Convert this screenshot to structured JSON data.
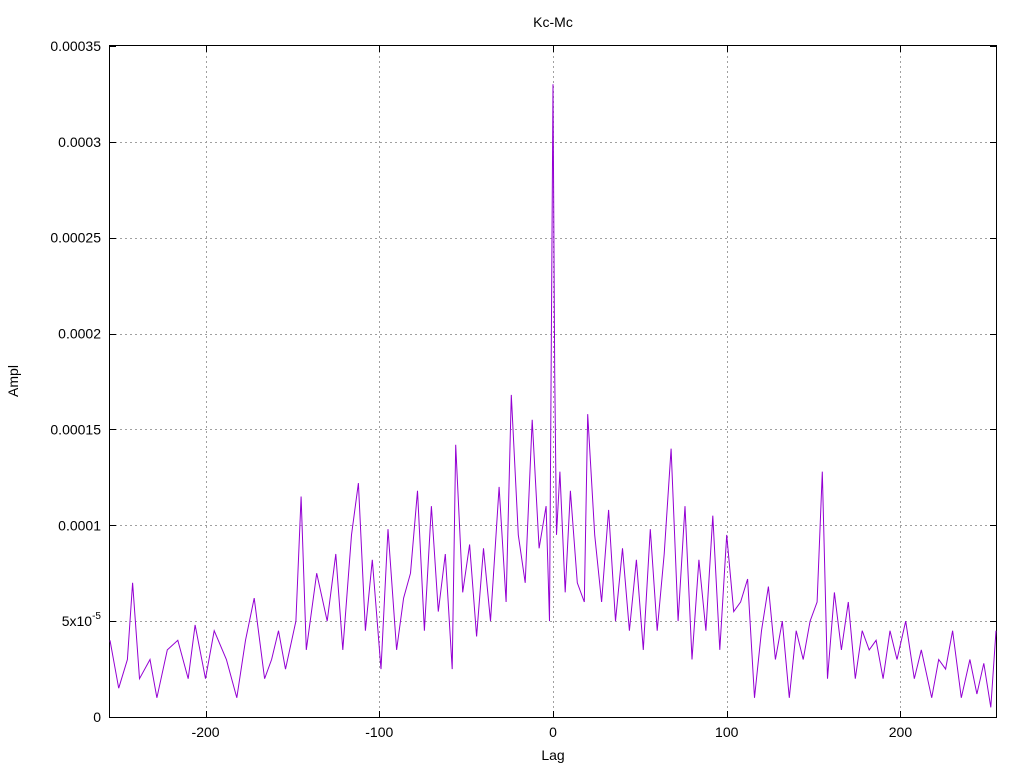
{
  "chart_data": {
    "type": "line",
    "title": "Kc-Mc",
    "xlabel": "Lag",
    "ylabel": "Ampl",
    "xlim": [
      -255,
      255
    ],
    "ylim": [
      0,
      0.00035
    ],
    "x_ticks": [
      -200,
      -100,
      0,
      100,
      200
    ],
    "x_tick_labels": [
      "-200",
      "-100",
      "0",
      "100",
      "200"
    ],
    "y_ticks": [
      0,
      5e-05,
      0.0001,
      0.00015,
      0.0002,
      0.00025,
      0.0003,
      0.00035
    ],
    "y_tick_labels": [
      "0",
      "5x10",
      "0.0001",
      "0.00015",
      "0.0002",
      "0.00025",
      "0.0003",
      "0.00035"
    ],
    "y_tick_exponent": "-5",
    "grid": true,
    "line_color": "#9400d3",
    "series": [
      {
        "points": [
          [
            -255,
            4e-05
          ],
          [
            -250,
            1.5e-05
          ],
          [
            -245,
            3e-05
          ],
          [
            -242,
            7e-05
          ],
          [
            -238,
            2e-05
          ],
          [
            -232,
            3e-05
          ],
          [
            -228,
            1e-05
          ],
          [
            -222,
            3.5e-05
          ],
          [
            -216,
            4e-05
          ],
          [
            -210,
            2e-05
          ],
          [
            -206,
            4.8e-05
          ],
          [
            -200,
            2e-05
          ],
          [
            -195,
            4.5e-05
          ],
          [
            -188,
            3e-05
          ],
          [
            -182,
            1e-05
          ],
          [
            -177,
            4e-05
          ],
          [
            -172,
            6.2e-05
          ],
          [
            -166,
            2e-05
          ],
          [
            -162,
            3e-05
          ],
          [
            -158,
            4.5e-05
          ],
          [
            -154,
            2.5e-05
          ],
          [
            -148,
            5e-05
          ],
          [
            -145,
            0.000115
          ],
          [
            -142,
            3.5e-05
          ],
          [
            -136,
            7.5e-05
          ],
          [
            -130,
            5e-05
          ],
          [
            -125,
            8.5e-05
          ],
          [
            -121,
            3.5e-05
          ],
          [
            -116,
            9.5e-05
          ],
          [
            -112,
            0.000122
          ],
          [
            -108,
            4.5e-05
          ],
          [
            -104,
            8.2e-05
          ],
          [
            -99,
            2.5e-05
          ],
          [
            -95,
            9.8e-05
          ],
          [
            -90,
            3.5e-05
          ],
          [
            -86,
            6.2e-05
          ],
          [
            -82,
            7.5e-05
          ],
          [
            -78,
            0.000118
          ],
          [
            -74,
            4.5e-05
          ],
          [
            -70,
            0.00011
          ],
          [
            -66,
            5.5e-05
          ],
          [
            -62,
            8.5e-05
          ],
          [
            -58,
            2.5e-05
          ],
          [
            -56,
            0.000142
          ],
          [
            -52,
            6.5e-05
          ],
          [
            -48,
            9e-05
          ],
          [
            -44,
            4.2e-05
          ],
          [
            -40,
            8.8e-05
          ],
          [
            -36,
            5e-05
          ],
          [
            -31,
            0.00012
          ],
          [
            -27,
            6e-05
          ],
          [
            -24,
            0.000168
          ],
          [
            -20,
            9.5e-05
          ],
          [
            -16,
            7e-05
          ],
          [
            -12,
            0.000155
          ],
          [
            -8,
            8.8e-05
          ],
          [
            -4,
            0.00011
          ],
          [
            -2,
            5e-05
          ],
          [
            0,
            0.00033
          ],
          [
            1,
            0.00018
          ],
          [
            2,
            9.5e-05
          ],
          [
            4,
            0.000128
          ],
          [
            7,
            6.5e-05
          ],
          [
            10,
            0.000118
          ],
          [
            14,
            7e-05
          ],
          [
            18,
            6e-05
          ],
          [
            20,
            0.000158
          ],
          [
            24,
            9.5e-05
          ],
          [
            28,
            6e-05
          ],
          [
            32,
            0.000108
          ],
          [
            36,
            5e-05
          ],
          [
            40,
            8.8e-05
          ],
          [
            44,
            4.5e-05
          ],
          [
            48,
            8.2e-05
          ],
          [
            52,
            3.5e-05
          ],
          [
            56,
            9.8e-05
          ],
          [
            60,
            4.5e-05
          ],
          [
            64,
            8.5e-05
          ],
          [
            68,
            0.00014
          ],
          [
            72,
            5e-05
          ],
          [
            76,
            0.00011
          ],
          [
            80,
            3e-05
          ],
          [
            84,
            8.2e-05
          ],
          [
            88,
            4.5e-05
          ],
          [
            92,
            0.000105
          ],
          [
            96,
            3.5e-05
          ],
          [
            100,
            9.5e-05
          ],
          [
            104,
            5.5e-05
          ],
          [
            108,
            6e-05
          ],
          [
            112,
            7.2e-05
          ],
          [
            116,
            1e-05
          ],
          [
            120,
            4.5e-05
          ],
          [
            124,
            6.8e-05
          ],
          [
            128,
            3e-05
          ],
          [
            132,
            5e-05
          ],
          [
            136,
            1e-05
          ],
          [
            140,
            4.5e-05
          ],
          [
            144,
            3e-05
          ],
          [
            148,
            5e-05
          ],
          [
            152,
            6e-05
          ],
          [
            155,
            0.000128
          ],
          [
            158,
            2e-05
          ],
          [
            162,
            6.5e-05
          ],
          [
            166,
            3.5e-05
          ],
          [
            170,
            6e-05
          ],
          [
            174,
            2e-05
          ],
          [
            178,
            4.5e-05
          ],
          [
            182,
            3.5e-05
          ],
          [
            186,
            4e-05
          ],
          [
            190,
            2e-05
          ],
          [
            194,
            4.5e-05
          ],
          [
            198,
            3e-05
          ],
          [
            203,
            5e-05
          ],
          [
            208,
            2e-05
          ],
          [
            212,
            3.5e-05
          ],
          [
            218,
            1e-05
          ],
          [
            222,
            3e-05
          ],
          [
            226,
            2.5e-05
          ],
          [
            230,
            4.5e-05
          ],
          [
            235,
            1e-05
          ],
          [
            240,
            3e-05
          ],
          [
            244,
            1.2e-05
          ],
          [
            248,
            2.8e-05
          ],
          [
            252,
            5e-06
          ],
          [
            255,
            4.5e-05
          ]
        ]
      }
    ]
  }
}
